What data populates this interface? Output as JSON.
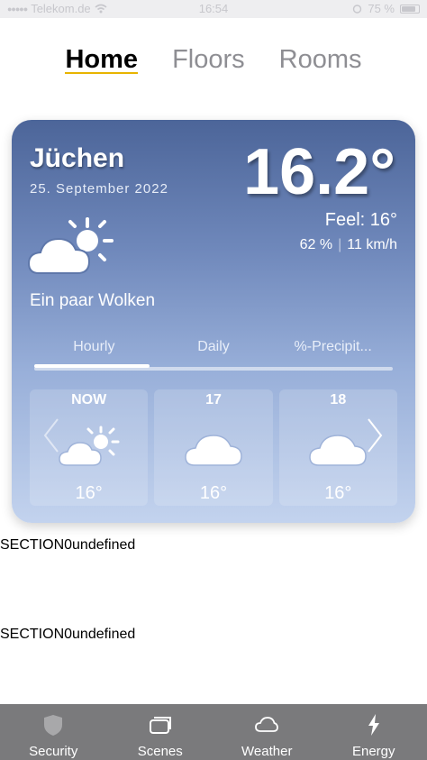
{
  "status_bar": {
    "carrier": "Telekom.de",
    "time": "16:54",
    "battery": "75 %"
  },
  "top_nav": {
    "tabs": [
      "Home",
      "Floors",
      "Rooms"
    ],
    "active": "Home"
  },
  "weather": {
    "city": "Jüchen",
    "date": "25. September 2022",
    "temperature": "16.2°",
    "feel": "Feel: 16°",
    "humidity": "62 %",
    "wind": "11 km/h",
    "condition": "Ein paar Wolken",
    "tabs": [
      "Hourly",
      "Daily",
      "%-Precipit..."
    ],
    "active_tab": "Hourly",
    "hourly": [
      {
        "label": "NOW",
        "temp": "16°",
        "icon": "partly-cloudy-icon"
      },
      {
        "label": "17",
        "temp": "16°",
        "icon": "cloud-icon"
      },
      {
        "label": "18",
        "temp": "16°",
        "icon": "cloud-icon"
      }
    ]
  },
  "sections": [
    "SECTION0undefined",
    "SECTION0undefined"
  ],
  "tab_bar": {
    "items": [
      "Security",
      "Scenes",
      "Weather",
      "Energy"
    ]
  },
  "colors": {
    "accent_underline": "#e8b400",
    "tab_bar_bg": "#7a7a7c"
  }
}
